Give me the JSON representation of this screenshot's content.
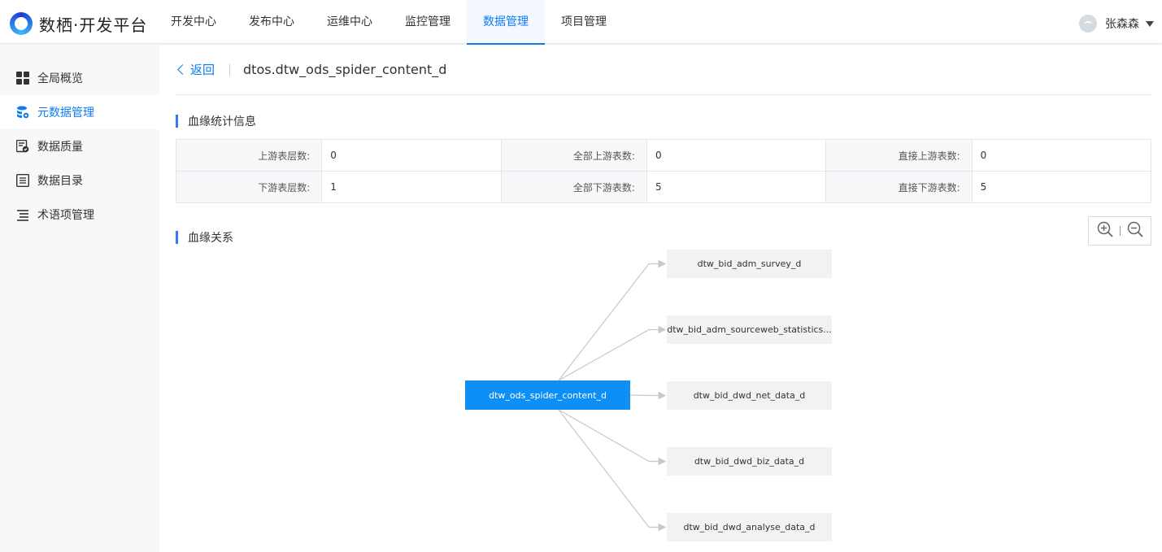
{
  "app": {
    "title": "数栖·开发平台"
  },
  "nav": {
    "items": [
      "开发中心",
      "发布中心",
      "运维中心",
      "监控管理",
      "数据管理",
      "项目管理"
    ],
    "active": "数据管理"
  },
  "user": {
    "name": "张森森"
  },
  "sidebar": {
    "items": [
      {
        "label": "全局概览",
        "icon": "grid-icon"
      },
      {
        "label": "元数据管理",
        "icon": "database-settings-icon",
        "active": true
      },
      {
        "label": "数据质量",
        "icon": "quality-check-icon"
      },
      {
        "label": "数据目录",
        "icon": "catalog-list-icon"
      },
      {
        "label": "术语项管理",
        "icon": "terms-list-icon"
      }
    ]
  },
  "header": {
    "back_label": "返回",
    "table_name": "dtos.dtw_ods_spider_content_d"
  },
  "stats": {
    "title": "血缘统计信息",
    "rows": [
      [
        {
          "label": "上游表层数:",
          "value": "0"
        },
        {
          "label": "全部上游表数:",
          "value": "0"
        },
        {
          "label": "直接上游表数:",
          "value": "0"
        }
      ],
      [
        {
          "label": "下游表层数:",
          "value": "1"
        },
        {
          "label": "全部下游表数:",
          "value": "5"
        },
        {
          "label": "直接下游表数:",
          "value": "5"
        }
      ]
    ]
  },
  "lineage": {
    "title": "血缘关系",
    "root": "dtw_ods_spider_content_d",
    "children": [
      "dtw_bid_adm_survey_d",
      "dtw_bid_adm_sourceweb_statistics...",
      "dtw_bid_dwd_net_data_d",
      "dtw_bid_dwd_biz_data_d",
      "dtw_bid_dwd_analyse_data_d"
    ],
    "colors": {
      "root": "#0e8ff5",
      "child": "#f2f2f2",
      "edge": "#c8c8c8"
    }
  }
}
